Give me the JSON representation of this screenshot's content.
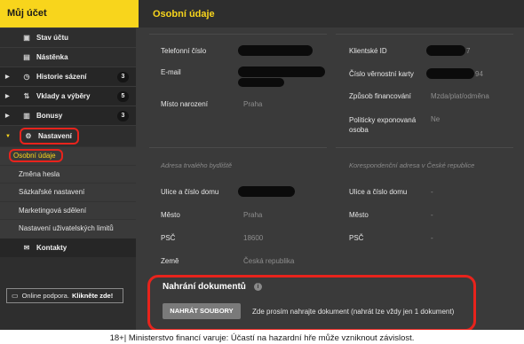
{
  "sidebar": {
    "title": "Můj účet",
    "items": [
      {
        "label": "Stav účtu",
        "icon": "wallet-icon",
        "glyph": "▣"
      },
      {
        "label": "Nástěnka",
        "icon": "notice-board-icon",
        "glyph": "▤"
      },
      {
        "label": "Historie sázení",
        "icon": "history-icon",
        "glyph": "◷",
        "badge": "3"
      },
      {
        "label": "Vklady a výběry",
        "icon": "transfer-icon",
        "glyph": "⇅",
        "badge": "5"
      },
      {
        "label": "Bonusy",
        "icon": "bonus-icon",
        "glyph": "▥",
        "badge": "3"
      },
      {
        "label": "Nastavení",
        "icon": "settings-icon",
        "glyph": "⚙"
      }
    ],
    "sub_items": [
      "Osobní údaje",
      "Změna hesla",
      "Sázkařské nastavení",
      "Marketingová sdělení",
      "Nastavení uživatelských limitů"
    ],
    "contacts": {
      "label": "Kontakty",
      "icon": "mail-icon",
      "glyph": "✉"
    },
    "support_text": "Online podpora.",
    "support_link": "Klikněte zde!"
  },
  "main": {
    "title": "Osobní údaje",
    "left_fields": [
      {
        "label": "Telefonní číslo",
        "value": ""
      },
      {
        "label": "E-mail",
        "value": ""
      },
      {
        "label": "Místo narození",
        "value": "Praha"
      }
    ],
    "right_fields": [
      {
        "label": "Klientské ID",
        "value": "7"
      },
      {
        "label": "Číslo věrnostní karty",
        "value": "94"
      },
      {
        "label": "Způsob financování",
        "value": "Mzda/plat/odměna"
      },
      {
        "label": "Politicky exponovaná osoba",
        "value": "Ne"
      }
    ],
    "address_left": {
      "title": "Adresa trvalého bydliště",
      "fields": [
        {
          "label": "Ulice a číslo domu",
          "value": ""
        },
        {
          "label": "Město",
          "value": "Praha"
        },
        {
          "label": "PSČ",
          "value": "18600"
        },
        {
          "label": "Země",
          "value": "Česká republika"
        }
      ]
    },
    "address_right": {
      "title": "Korespondenční adresa v České republice",
      "fields": [
        {
          "label": "Ulice a číslo domu",
          "value": "-"
        },
        {
          "label": "Město",
          "value": "-"
        },
        {
          "label": "PSČ",
          "value": "-"
        }
      ]
    },
    "upload": {
      "title": "Nahrání dokumentů",
      "button": "NAHRÁT SOUBORY",
      "hint": "Zde prosím nahrajte dokument (nahrát lze vždy jen 1 dokument)"
    }
  },
  "footer": "18+| Ministerstvo financí varuje: Účastí na hazardní hře může vzniknout závislost."
}
